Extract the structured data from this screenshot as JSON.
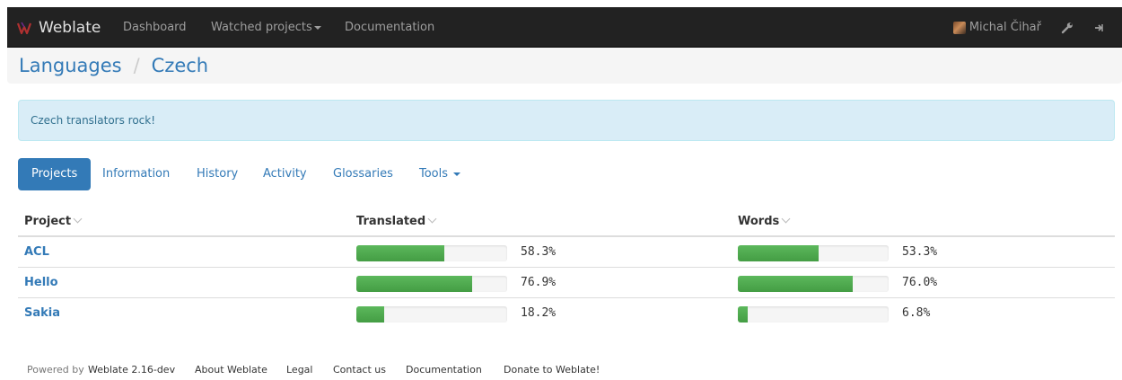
{
  "navbar": {
    "brand": "Weblate",
    "links": [
      "Dashboard",
      "Watched projects",
      "Documentation"
    ],
    "user": "Michal Čihař",
    "icons": [
      "wrench-icon",
      "logout-icon"
    ]
  },
  "breadcrumb": {
    "root": "Languages",
    "separator": "/",
    "current": "Czech"
  },
  "alert": {
    "text": "Czech translators rock!"
  },
  "tabs": [
    "Projects",
    "Information",
    "History",
    "Activity",
    "Glossaries",
    "Tools"
  ],
  "table": {
    "headers": [
      "Project",
      "Translated",
      "Words"
    ],
    "rows": [
      {
        "project": "ACL",
        "translated": "58.3%",
        "translated_value": 58.3,
        "words": "53.3%",
        "words_value": 53.3
      },
      {
        "project": "Hello",
        "translated": "76.9%",
        "translated_value": 76.9,
        "words": "76.0%",
        "words_value": 76.0
      },
      {
        "project": "Sakia",
        "translated": "18.2%",
        "translated_value": 18.2,
        "words": "6.8%",
        "words_value": 6.8
      }
    ]
  },
  "footer": {
    "powered_prefix": "Powered by",
    "powered_link": "Weblate 2.16-dev",
    "links": [
      "About Weblate",
      "Legal",
      "Contact us",
      "Documentation",
      "Donate to Weblate!"
    ]
  },
  "colors": {
    "navbar": "#222222",
    "link": "#337ab7",
    "progress": "#5cb85c",
    "alert_bg": "#d9edf7"
  }
}
